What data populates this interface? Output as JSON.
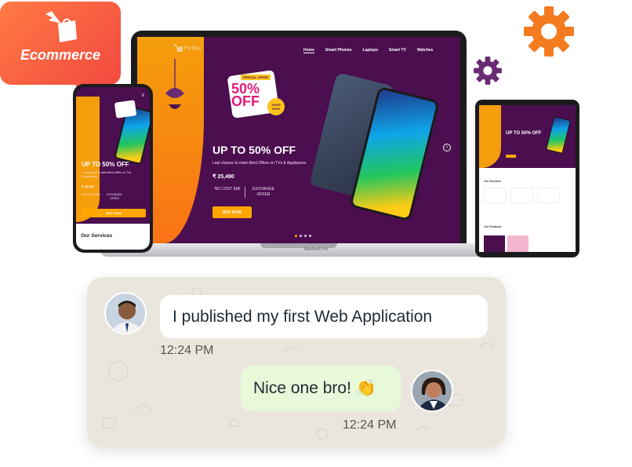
{
  "badge": {
    "label": "Ecommerce"
  },
  "laptop": {
    "brand": "Fly Buy",
    "menu": [
      "Home",
      "Smart Phones",
      "Laptops",
      "Smart TV",
      "Watches"
    ],
    "offer": {
      "tag": "SPECIAL OFFER",
      "discount": "50%",
      "off": "OFF",
      "shop": "SHOP NOW"
    },
    "hero_title": "UP TO 50% OFF",
    "hero_sub": "Last chance to claim Best Offers on TVs & Appliances",
    "price": "₹ 25,490",
    "feature_1": "NO COST EMI",
    "feature_2": "EXCHANGE OFFER",
    "cta": "BUY NOW",
    "next": "›",
    "model_label": "MacBook Pro"
  },
  "mobile": {
    "hero_title": "UP TO 50% OFF",
    "hero_sub": "...ast chance to claim Best Offers on TVs & Appliances",
    "price": "₹ 25,490",
    "feature_1": "NO COST EMI",
    "feature_2": "EXCHANGE OFFER",
    "cta": "BUY NOW",
    "services_title": "Our Services",
    "menu_icon": "≡"
  },
  "tablet": {
    "hero_title": "UP TO 50% OFF",
    "services_title": "Our Services",
    "products_title": "Our Products"
  },
  "chat": {
    "message_1": "I published my first Web Application",
    "time_1": "12:24 PM",
    "message_2": "Nice one bro! 👏",
    "time_2": "12:24 PM"
  },
  "colors": {
    "brand_purple": "#4b0e4f",
    "brand_orange": "#ffa600",
    "badge_red": "#f2493f",
    "gear_orange": "#f47b20",
    "gear_purple": "#6b2a74"
  }
}
